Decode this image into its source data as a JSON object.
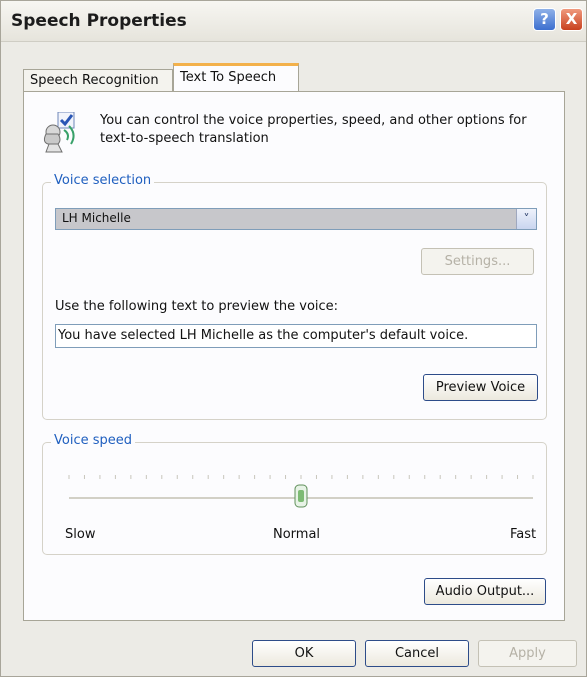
{
  "window": {
    "title": "Speech Properties",
    "help_glyph": "?",
    "close_glyph": "X"
  },
  "tabs": [
    {
      "label": "Speech Recognition",
      "selected": false
    },
    {
      "label": "Text To Speech",
      "selected": true
    }
  ],
  "info": {
    "icon": "speech-assistant-icon",
    "text": "You can control the voice properties, speed, and other options for text-to-speech translation"
  },
  "voice_selection": {
    "label": "Voice selection",
    "selected_voice": "LH Michelle",
    "dropdown_arrow": "˅",
    "settings_label": "Settings...",
    "preview_prompt": "Use the following text to preview the voice:",
    "preview_text": "You have selected LH Michelle as the computer's default voice.",
    "preview_button": "Preview Voice"
  },
  "voice_speed": {
    "label": "Voice speed",
    "slow_label": "Slow",
    "normal_label": "Normal",
    "fast_label": "Fast",
    "position_fraction": 0.5
  },
  "audio_output_button": "Audio Output...",
  "dialog_buttons": {
    "ok": "OK",
    "cancel": "Cancel",
    "apply": "Apply"
  },
  "colors": {
    "group_label": "#1f5fbf",
    "tab_accent": "#f3b14b",
    "dropdown_fill": "#c7c7cb"
  }
}
